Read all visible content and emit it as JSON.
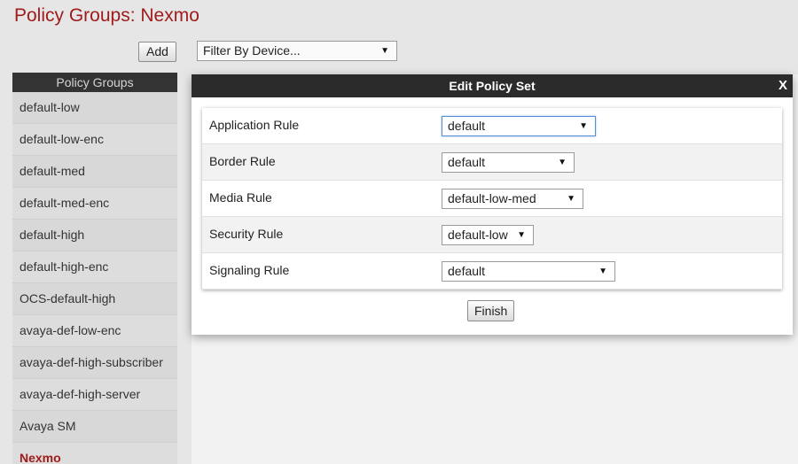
{
  "page": {
    "title": "Policy Groups: Nexmo"
  },
  "toolbar": {
    "add_label": "Add",
    "filter_select": "Filter By Device..."
  },
  "sidebar": {
    "header": "Policy Groups",
    "items": [
      "default-low",
      "default-low-enc",
      "default-med",
      "default-med-enc",
      "default-high",
      "default-high-enc",
      "OCS-default-high",
      "avaya-def-low-enc",
      "avaya-def-high-subscriber",
      "avaya-def-high-server",
      "Avaya SM",
      "Nexmo"
    ],
    "active_item": "Nexmo"
  },
  "modal": {
    "title": "Edit Policy Set",
    "close_label": "X",
    "rules": [
      {
        "label": "Application Rule",
        "value": "default"
      },
      {
        "label": "Border Rule",
        "value": "default"
      },
      {
        "label": "Media Rule",
        "value": "default-low-med"
      },
      {
        "label": "Security Rule",
        "value": "default-low"
      },
      {
        "label": "Signaling Rule",
        "value": "default"
      }
    ],
    "finish_label": "Finish"
  },
  "icons": {
    "dropdown": "chevron-down-icon"
  },
  "colors": {
    "title": "#a01c1c",
    "header_bg": "#2b2b2b",
    "sidebar_header_bg": "#333333"
  }
}
